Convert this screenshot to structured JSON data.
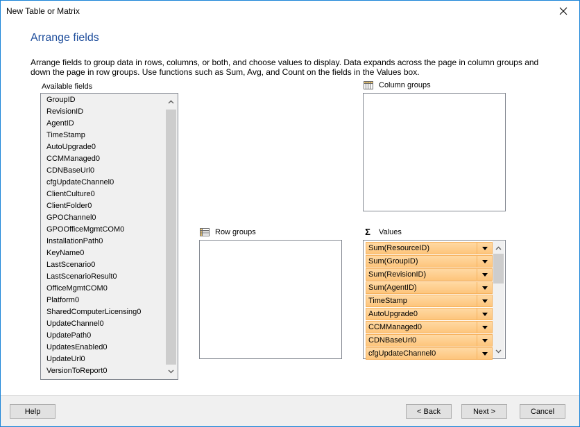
{
  "window": {
    "title": "New Table or Matrix",
    "close_icon": "close-icon"
  },
  "page": {
    "heading": "Arrange fields",
    "description": "Arrange fields to group data in rows, columns, or both, and choose values to display. Data expands across the page in column groups and down the page in row groups.  Use functions such as Sum, Avg, and Count on the fields in the Values box."
  },
  "available_fields": {
    "label": "Available fields",
    "items": [
      "GroupID",
      "RevisionID",
      "AgentID",
      "TimeStamp",
      "AutoUpgrade0",
      "CCMManaged0",
      "CDNBaseUrl0",
      "cfgUpdateChannel0",
      "ClientCulture0",
      "ClientFolder0",
      "GPOChannel0",
      "GPOOfficeMgmtCOM0",
      "InstallationPath0",
      "KeyName0",
      "LastScenario0",
      "LastScenarioResult0",
      "OfficeMgmtCOM0",
      "Platform0",
      "SharedComputerLicensing0",
      "UpdateChannel0",
      "UpdatePath0",
      "UpdatesEnabled0",
      "UpdateUrl0",
      "VersionToReport0"
    ]
  },
  "column_groups": {
    "label": "Column groups",
    "icon": "column-groups-icon",
    "items": []
  },
  "row_groups": {
    "label": "Row groups",
    "icon": "row-groups-icon",
    "items": []
  },
  "values": {
    "label": "Values",
    "icon": "sigma-icon",
    "items": [
      "Sum(ResourceID)",
      "Sum(GroupID)",
      "Sum(RevisionID)",
      "Sum(AgentID)",
      "TimeStamp",
      "AutoUpgrade0",
      "CCMManaged0",
      "CDNBaseUrl0",
      "cfgUpdateChannel0"
    ]
  },
  "footer": {
    "help_label": "Help",
    "back_label": "< Back",
    "next_label": "Next >",
    "cancel_label": "Cancel"
  },
  "colors": {
    "heading": "#1f4e9c",
    "window_border": "#1883d7",
    "value_item_fill": "#fdc57c",
    "value_item_border": "#f6b25e"
  }
}
